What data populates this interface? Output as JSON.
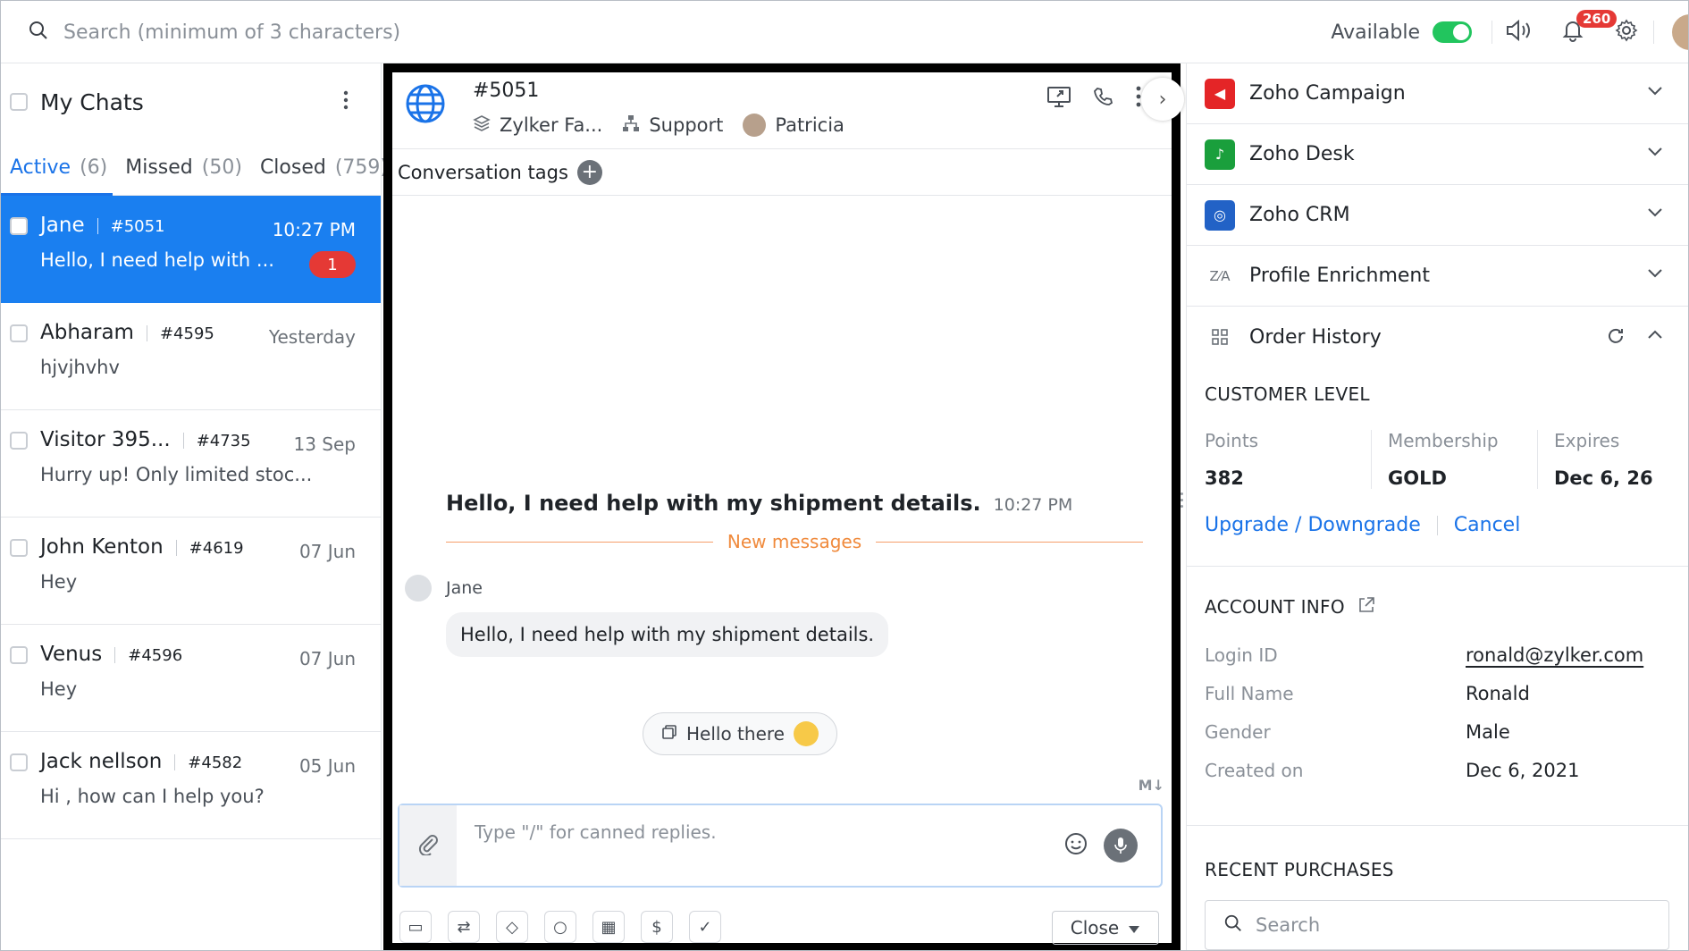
{
  "topbar": {
    "search_placeholder": "Search (minimum of 3 characters)",
    "status_label": "Available",
    "notification_count": "260"
  },
  "left": {
    "title": "My Chats",
    "tabs": [
      {
        "label": "Active",
        "count": "(6)"
      },
      {
        "label": "Missed",
        "count": "(50)"
      },
      {
        "label": "Closed",
        "count": "(759)"
      }
    ],
    "chats": [
      {
        "name": "Jane",
        "id": "#5051",
        "time": "10:27 PM",
        "message": "Hello, I need help with ...",
        "unread": "1"
      },
      {
        "name": "Abharam",
        "id": "#4595",
        "time": "Yesterday",
        "message": "hjvjhvhv"
      },
      {
        "name": "Visitor 395...",
        "id": "#4735",
        "time": "13 Sep",
        "message": "Hurry up! Only limited stoc..."
      },
      {
        "name": "John Kenton",
        "id": "#4619",
        "time": "07 Jun",
        "message": "Hey"
      },
      {
        "name": "Venus",
        "id": "#4596",
        "time": "07 Jun",
        "message": "Hey"
      },
      {
        "name": "Jack nellson",
        "id": "#4582",
        "time": "05 Jun",
        "message": "Hi , how can I help you?"
      }
    ]
  },
  "center": {
    "conversation_id": "#5051",
    "brand": "Zylker Fa...",
    "department": "Support",
    "agent": "Patricia",
    "tags_label": "Conversation tags",
    "first_message": "Hello, I need help with my shipment details.",
    "first_message_time": "10:27 PM",
    "new_messages_label": "New messages",
    "sender": "Jane",
    "bubble_text": "Hello, I need help with my shipment details.",
    "quick_reply": "Hello there",
    "markdown_label": "M↓",
    "composer_placeholder": "Type \"/\" for canned replies.",
    "close_label": "Close"
  },
  "right": {
    "integrations": [
      {
        "label": "Zoho Campaign",
        "color": "#e42527"
      },
      {
        "label": "Zoho Desk",
        "color": "#1a9f3c"
      },
      {
        "label": "Zoho CRM",
        "color": "#2262c6"
      },
      {
        "label": "Profile Enrichment"
      },
      {
        "label": "Order History"
      }
    ],
    "customer_level": {
      "title": "CUSTOMER LEVEL",
      "points_label": "Points",
      "points": "382",
      "membership_label": "Membership",
      "membership": "GOLD",
      "expires_label": "Expires",
      "expires": "Dec 6, 26",
      "upgrade_label": "Upgrade / Downgrade",
      "cancel_label": "Cancel"
    },
    "account_info": {
      "title": "ACCOUNT INFO",
      "login_label": "Login ID",
      "login": "ronald@zylker.com",
      "fullname_label": "Full Name",
      "fullname": "Ronald",
      "gender_label": "Gender",
      "gender": "Male",
      "created_label": "Created on",
      "created": "Dec 6, 2021"
    },
    "recent_purchases": {
      "title": "RECENT PURCHASES",
      "search_placeholder": "Search"
    }
  }
}
